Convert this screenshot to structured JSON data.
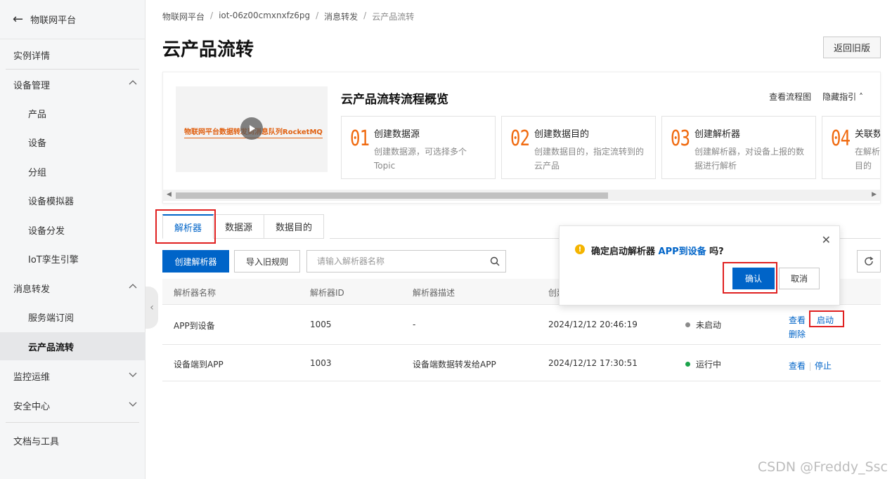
{
  "sidebar": {
    "back_label": "物联网平台",
    "items": [
      {
        "label": "实例详情"
      },
      {
        "label": "设备管理"
      },
      {
        "label": "产品"
      },
      {
        "label": "设备"
      },
      {
        "label": "分组"
      },
      {
        "label": "设备模拟器"
      },
      {
        "label": "设备分发"
      },
      {
        "label": "IoT孪生引擎"
      },
      {
        "label": "消息转发"
      },
      {
        "label": "服务端订阅"
      },
      {
        "label": "云产品流转"
      },
      {
        "label": "监控运维"
      },
      {
        "label": "安全中心"
      },
      {
        "label": "文档与工具"
      }
    ]
  },
  "breadcrumb": [
    "物联网平台",
    "iot-06z00cmxnxfz6pg",
    "消息转发",
    "云产品流转"
  ],
  "page": {
    "title": "云产品流转",
    "old_version_label": "返回旧版"
  },
  "guide": {
    "title": "云产品流转流程概览",
    "video_caption": "物联网平台数据转发到消息队列RocketMQ",
    "view_flow_label": "查看流程图",
    "hide_guide_label": "隐藏指引",
    "steps": [
      {
        "num": "01",
        "title": "创建数据源",
        "desc": "创建数据源，可选择多个Topic"
      },
      {
        "num": "02",
        "title": "创建数据目的",
        "desc": "创建数据目的，指定流转到的云产品"
      },
      {
        "num": "03",
        "title": "创建解析器",
        "desc": "创建解析器，对设备上报的数据进行解析"
      },
      {
        "num": "04",
        "title": "关联数据源",
        "desc": "在解析器中关联数据源和数据目的"
      }
    ]
  },
  "tabs": [
    {
      "label": "解析器"
    },
    {
      "label": "数据源"
    },
    {
      "label": "数据目的"
    }
  ],
  "toolbar": {
    "create_label": "创建解析器",
    "import_label": "导入旧规则",
    "search_placeholder": "请输入解析器名称"
  },
  "table": {
    "headers": [
      "解析器名称",
      "解析器ID",
      "解析器描述",
      "创建时间"
    ],
    "rows": [
      {
        "name": "APP到设备",
        "id": "1005",
        "desc": "-",
        "created": "2024/12/12 20:46:19",
        "status": "未启动",
        "status_color": "#8a8a8a",
        "actions": [
          "查看",
          "启动",
          "删除"
        ]
      },
      {
        "name": "设备端到APP",
        "id": "1003",
        "desc": "设备端数据转发给APP",
        "created": "2024/12/12 17:30:51",
        "status": "运行中",
        "status_color": "#1aa34a",
        "actions": [
          "查看",
          "停止"
        ]
      }
    ]
  },
  "popover": {
    "message_prefix": "确定启动解析器 ",
    "message_highlight": "APP到设备",
    "message_suffix": " 吗?",
    "confirm_label": "确认",
    "cancel_label": "取消"
  },
  "colors": {
    "primary": "#0064c8",
    "annotation": "#e02020",
    "step_number": "#f06a0f"
  },
  "watermark": "CSDN @Freddy_Ssc"
}
